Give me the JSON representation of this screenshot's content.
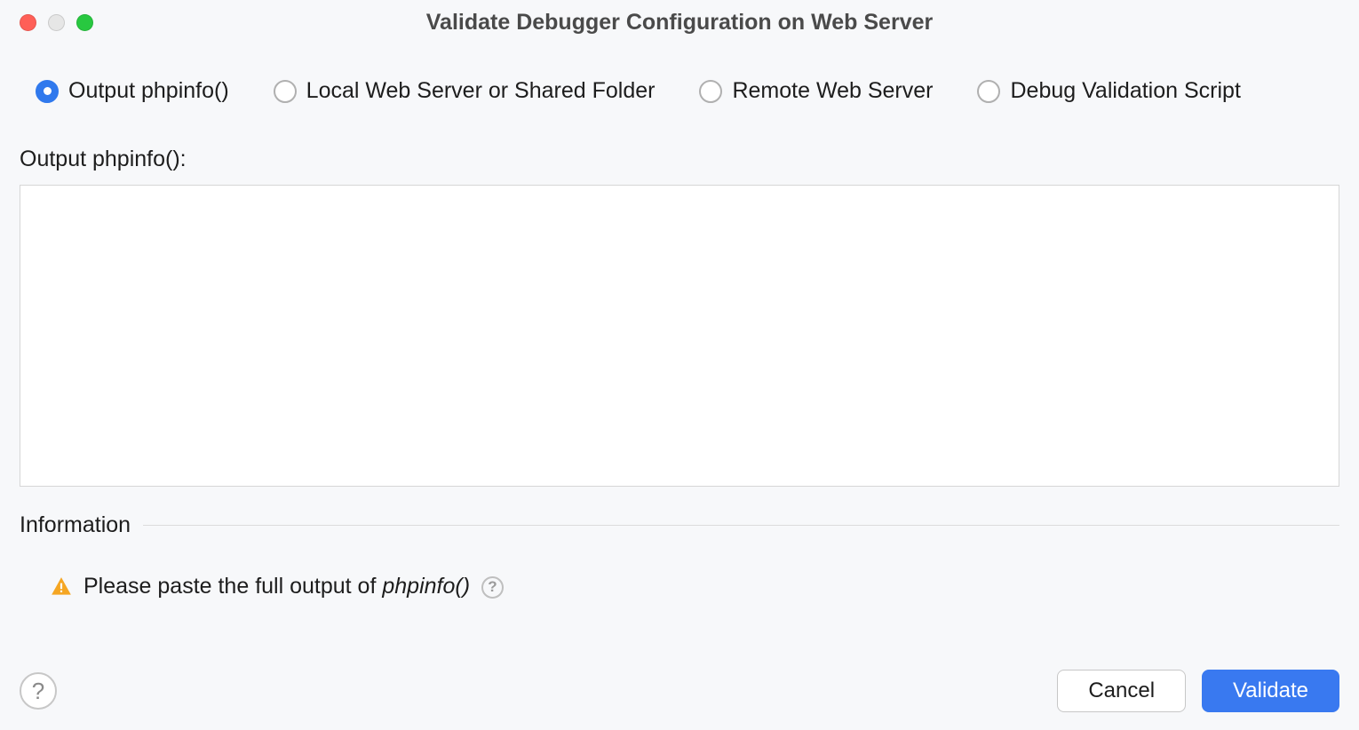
{
  "window": {
    "title": "Validate Debugger Configuration on Web Server"
  },
  "radios": {
    "output_phpinfo": "Output phpinfo()",
    "local_web_server": "Local Web Server or Shared Folder",
    "remote_web_server": "Remote Web Server",
    "debug_validation_script": "Debug Validation Script",
    "selected": "output_phpinfo"
  },
  "field": {
    "label": "Output phpinfo():",
    "value": ""
  },
  "information": {
    "section_title": "Information",
    "message_prefix": "Please paste the full output of",
    "message_italic": "phpinfo()"
  },
  "buttons": {
    "cancel": "Cancel",
    "validate": "Validate",
    "help_glyph": "?"
  }
}
